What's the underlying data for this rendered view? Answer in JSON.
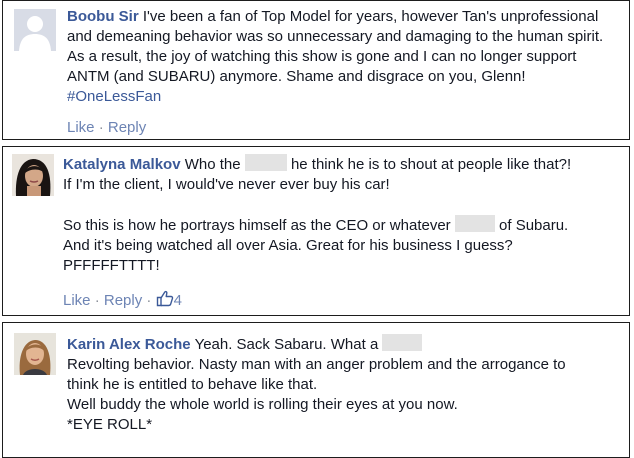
{
  "comments": [
    {
      "author": "Boobu Sir",
      "text": "I've been a fan of Top Model for years, however Tan's unprofessional and demeaning behavior was so unnecessary and damaging to the human spirit. As a result, the joy of watching this show is gone and I can no longer support ANTM (and SUBARU) anymore. Shame and disgrace on you, Glenn!",
      "hashtag": "#OneLessFan",
      "actions": {
        "like": "Like",
        "separator": "·",
        "reply": "Reply"
      }
    },
    {
      "author": "Katalyna Malkov",
      "text_1a": "Who the",
      "text_1b": "he think he is to shout at people like that?!",
      "text_2": "If I'm the client, I would've never ever buy his car!",
      "text_3a": "So this is how he portrays himself as the CEO or whatever",
      "text_3b": "of Subaru.",
      "text_4": "And it's being watched all over Asia. Great for his business I guess?",
      "text_5": "PFFFFFTTTT!",
      "actions": {
        "like": "Like",
        "separator": "·",
        "reply": "Reply",
        "like_count": "4"
      }
    },
    {
      "author": "Karin Alex Roche",
      "text_1": "Yeah. Sack Sabaru. What a",
      "text_2": "Revolting behavior. Nasty man with an anger problem and the arrogance to",
      "text_3": "think he is entitled to behave like that.",
      "text_4": "Well buddy the whole world is rolling their eyes at you now.",
      "text_5": "*EYE ROLL*"
    }
  ],
  "colors": {
    "link": "#3b5998",
    "action_link": "#6d84b4",
    "redaction": "#e3e3e3",
    "border": "#1d1d1d"
  },
  "icons": {
    "avatar_placeholder": "default-silhouette-icon",
    "like": "thumbs-up-icon"
  }
}
